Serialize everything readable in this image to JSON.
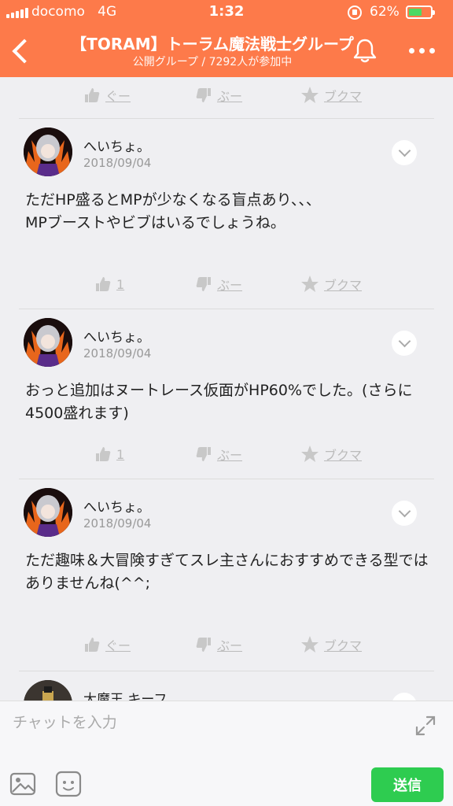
{
  "status_bar": {
    "carrier": "docomo",
    "network": "4G",
    "time": "1:32",
    "battery_percent": "62%",
    "battery_level": 0.62
  },
  "header": {
    "title": "【TORAM】トーラム魔法戦士グループ",
    "subtitle": "公開グループ / 7292人が参加中",
    "back_icon": "chevron-left-icon",
    "bell_icon": "bell-icon",
    "more_icon": "more-dots-icon"
  },
  "top_actions": {
    "like_label": "ぐー",
    "dislike_label": "ぶー",
    "bookmark_label": "ブクマ"
  },
  "posts": [
    {
      "author": "へいちょ。",
      "date": "2018/09/04",
      "body": "ただHP盛るとMPが少なくなる盲点あり、、、\nMPブーストやビブはいるでしょうね。",
      "like_label": "1",
      "dislike_label": "ぶー",
      "bookmark_label": "ブクマ"
    },
    {
      "author": "へいちょ。",
      "date": "2018/09/04",
      "body": "おっと追加はヌートレース仮面がHP60%でした。(さらに4500盛れます)",
      "like_label": "1",
      "dislike_label": "ぶー",
      "bookmark_label": "ブクマ"
    },
    {
      "author": "へいちょ。",
      "date": "2018/09/04",
      "body": "ただ趣味＆大冒険すぎてスレ主さんにおすすめできる型ではありませんね(^^;",
      "like_label": "ぐー",
      "dislike_label": "ぶー",
      "bookmark_label": "ブクマ"
    },
    {
      "author": "大魔王 キーフ"
    }
  ],
  "composer": {
    "placeholder": "チャットを入力",
    "value": "",
    "send_label": "送信",
    "image_icon": "image-icon",
    "sticker_icon": "sticker-icon",
    "expand_icon": "expand-icon"
  },
  "colors": {
    "header_bg": "#fd7a4a",
    "send_bg": "#2ecc50",
    "feed_bg": "#efeff2"
  }
}
